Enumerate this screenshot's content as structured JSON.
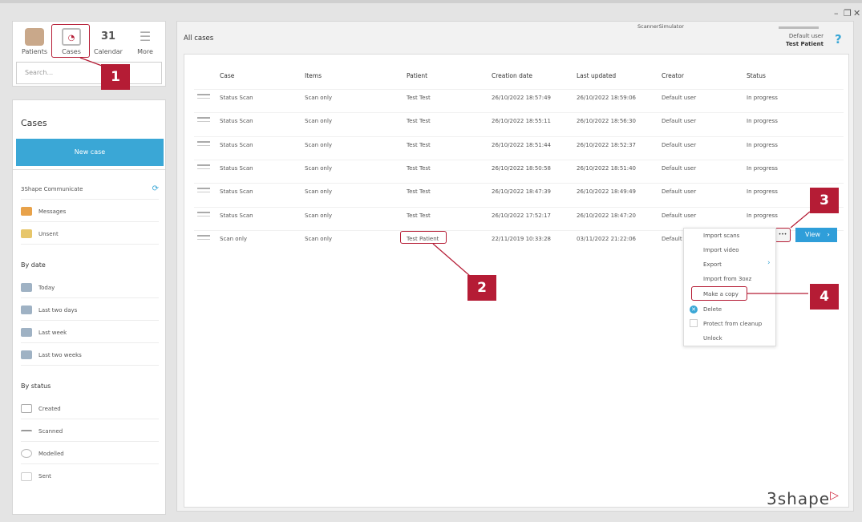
{
  "window": {
    "title": "ScannerSimulator",
    "min": "–",
    "restore": "❐",
    "close": "✕"
  },
  "user": {
    "name": "Default user",
    "patient": "Test Patient",
    "help": "?"
  },
  "nav": [
    {
      "label": "Patients",
      "icon": "patients-icon"
    },
    {
      "label": "Cases",
      "icon": "cases-icon"
    },
    {
      "label": "Calendar",
      "icon": "calendar-icon",
      "glyph": "31"
    },
    {
      "label": "More",
      "icon": "more-icon"
    }
  ],
  "search": {
    "placeholder": "Search..."
  },
  "cases_panel": {
    "title": "Cases",
    "new_case": "New case",
    "communicate": "3Shape Communicate",
    "comm_items": [
      "Messages",
      "Unsent"
    ],
    "by_date": "By date",
    "date_items": [
      "Today",
      "Last two days",
      "Last week",
      "Last two weeks"
    ],
    "by_status": "By status",
    "status_items": [
      "Created",
      "Scanned",
      "Modelled",
      "Sent"
    ]
  },
  "main": {
    "heading": "All cases",
    "columns": [
      "Case",
      "Items",
      "Patient",
      "Creation date",
      "Last updated",
      "Creator",
      "Status"
    ],
    "rows": [
      [
        "Status Scan",
        "Scan only",
        "Test Test",
        "26/10/2022 18:57:49",
        "26/10/2022 18:59:06",
        "Default user",
        "In progress"
      ],
      [
        "Status Scan",
        "Scan only",
        "Test Test",
        "26/10/2022 18:55:11",
        "26/10/2022 18:56:30",
        "Default user",
        "In progress"
      ],
      [
        "Status Scan",
        "Scan only",
        "Test Test",
        "26/10/2022 18:51:44",
        "26/10/2022 18:52:37",
        "Default user",
        "In progress"
      ],
      [
        "Status Scan",
        "Scan only",
        "Test Test",
        "26/10/2022 18:50:58",
        "26/10/2022 18:51:40",
        "Default user",
        "In progress"
      ],
      [
        "Status Scan",
        "Scan only",
        "Test Test",
        "26/10/2022 18:47:39",
        "26/10/2022 18:49:49",
        "Default user",
        "In progress"
      ],
      [
        "Status Scan",
        "Scan only",
        "Test Test",
        "26/10/2022 17:52:17",
        "26/10/2022 18:47:20",
        "Default user",
        "In progress"
      ],
      [
        "Scan only",
        "Scan only",
        "Test Patient",
        "22/11/2019 10:33:28",
        "03/11/2022 21:22:06",
        "Default op",
        ""
      ]
    ],
    "more_btn": "•••",
    "view_btn": "View"
  },
  "context_menu": [
    "Import scans",
    "Import video",
    "Export",
    "Import from 3oxz",
    "Make a copy",
    "Delete",
    "Protect from cleanup",
    "Unlock"
  ],
  "callouts": [
    "1",
    "2",
    "3",
    "4"
  ],
  "brand": "3shape",
  "colors": {
    "accent": "#3aa7d6",
    "callout": "#b51c35",
    "view": "#2f9ed9"
  }
}
